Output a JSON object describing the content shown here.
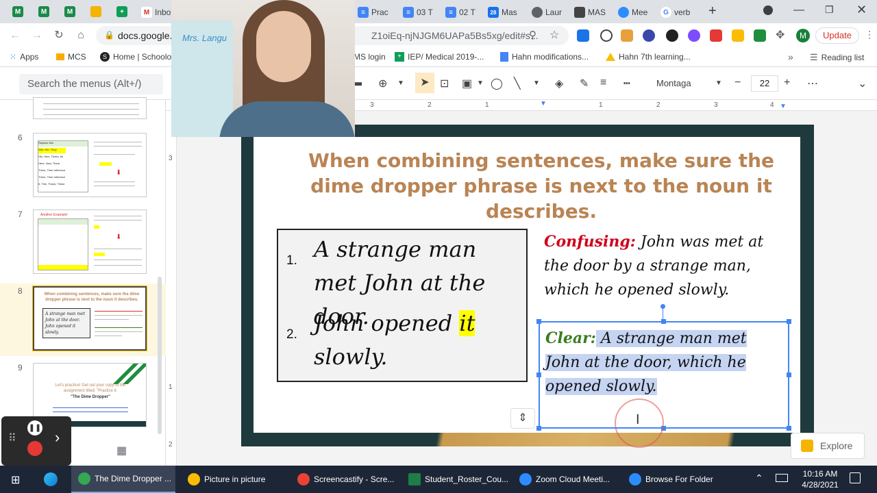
{
  "tabs": [
    {
      "label": "Inbox",
      "icon": "gmail-icon"
    },
    {
      "label": "Prac",
      "icon": "docs-icon"
    },
    {
      "label": "03 T",
      "icon": "docs-icon"
    },
    {
      "label": "02 T",
      "icon": "docs-icon"
    },
    {
      "label": "Mas",
      "icon": "calendar-icon"
    },
    {
      "label": "Laur",
      "icon": "globe-icon"
    },
    {
      "label": "MAS",
      "icon": "car-icon"
    },
    {
      "label": "Mee",
      "icon": "zoom-icon"
    },
    {
      "label": "verb",
      "icon": "google-icon"
    }
  ],
  "address": {
    "url_head": "docs.google.",
    "url_tail": "Z1oiEq-njNJGM6UAPa5Bs5xg/edit#s...",
    "update_label": "Update",
    "profile_initial": "M"
  },
  "bookmarks": [
    {
      "label": "Apps"
    },
    {
      "label": "MCS"
    },
    {
      "label": "Home | Schoolo"
    },
    {
      "label": "MS login"
    },
    {
      "label": "IEP/ Medical 2019-..."
    },
    {
      "label": "Hahn modifications..."
    },
    {
      "label": "Hahn 7th learning..."
    }
  ],
  "bookmarks_more": "»",
  "reading_list": "Reading list",
  "toolbar": {
    "menu_search": "Search the menus (Alt+/)",
    "font_name": "Montaga",
    "font_size": "22"
  },
  "ruler": {
    "h_labels": [
      "3",
      "2",
      "1",
      "1",
      "2",
      "3",
      "4"
    ],
    "v_labels": [
      "3",
      "1",
      "2"
    ]
  },
  "filmstrip": {
    "numbers": [
      "6",
      "7",
      "8",
      "9"
    ],
    "thumb6": {
      "rows": [
        "Replace this",
        "She, Her, They",
        "His, Hers, Theirs, Its",
        "Here, Now, There",
        "There, Time reference",
        "There, Time reference",
        "It, This, Those, These"
      ]
    },
    "thumb7": {
      "title": "Another Example!"
    },
    "thumb8": {
      "title": "When combining sentences, make sure the dime dropper phrase is next to the noun it describes.",
      "item1": "A strange man met John at the door.",
      "item2": "John opened it slowly."
    },
    "thumb9": {
      "line1": "Let's practice! Get out your copy of the assignment titled: \"Practice it:",
      "line2": "\"The Dime Dropper\""
    }
  },
  "slide": {
    "title": "When combining sentences, make sure the dime dropper phrase is next to the noun it describes.",
    "items": [
      {
        "num": "1.",
        "text": "A strange man met John at the door."
      },
      {
        "num": "2.",
        "text_before": "John opened ",
        "highlight": "it",
        "text_after": " slowly."
      }
    ],
    "confusing_label": "Confusing:",
    "confusing_text": " John was met at the door by a strange man, which he opened slowly.",
    "clear_label": "Clear:",
    "clear_text": " A strange man met John at the door, which he opened slowly."
  },
  "explore_label": "Explore",
  "webcam_sign": "Mrs. Langu",
  "taskbar": {
    "tasks": [
      {
        "label": "The Dime Dropper ..."
      },
      {
        "label": "Picture in picture"
      },
      {
        "label": "Screencastify - Scre..."
      },
      {
        "label": "Student_Roster_Cou..."
      },
      {
        "label": "Zoom Cloud Meeti..."
      },
      {
        "label": "Browse For Folder"
      }
    ],
    "time": "10:16 AM",
    "date": "4/28/2021"
  }
}
